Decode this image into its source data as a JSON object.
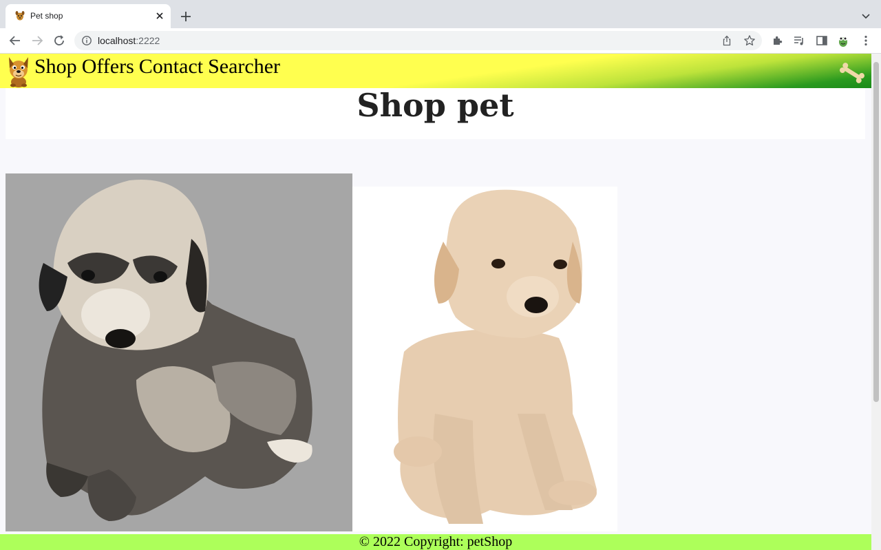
{
  "browser": {
    "tab_title": "Pet shop",
    "url_host": "localhost",
    "url_port": ":2222"
  },
  "site": {
    "nav": [
      {
        "label": "Shop"
      },
      {
        "label": "Offers"
      },
      {
        "label": "Contact"
      },
      {
        "label": "Searcher"
      }
    ],
    "page_title": "Shop pet",
    "footer_text": "© 2022 Copyright: petShop",
    "colors": {
      "nav_yellow": "#ffff4f",
      "nav_green": "#1a8a18",
      "footer_green": "#adff5a",
      "photo1_bg": "#a6a6a6"
    }
  },
  "icons": {
    "tab_favicon": "dog-icon",
    "logo": "cartoon-dog-logo",
    "nav_right": "bone-icon"
  }
}
